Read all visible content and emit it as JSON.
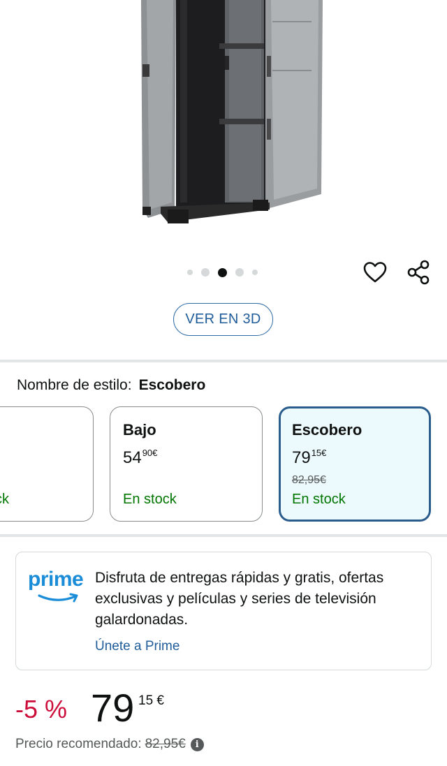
{
  "carousel": {
    "dot_count": 5,
    "active_index": 2
  },
  "actions": {
    "wishlist_icon": "heart-icon",
    "share_icon": "share-icon"
  },
  "view3d": {
    "label": "VER EN 3D"
  },
  "style": {
    "label": "Nombre de estilo:",
    "selected": "Escobero",
    "options": [
      {
        "name": "",
        "price_whole": "",
        "price_fraction": "",
        "currency": "",
        "old_price": "",
        "stock": "ck"
      },
      {
        "name": "Bajo",
        "price_whole": "54",
        "price_fraction": "90",
        "currency": "€",
        "old_price": "",
        "stock": "En stock"
      },
      {
        "name": "Escobero",
        "price_whole": "79",
        "price_fraction": "15",
        "currency": "€",
        "old_price": "82,95€",
        "stock": "En stock"
      }
    ]
  },
  "prime": {
    "logo_text": "prime",
    "description": "Disfruta de entregas rápidas y gratis, ofertas exclusivas y películas y series de televisión galardonadas.",
    "link": "Únete a Prime"
  },
  "price": {
    "discount": "-5 %",
    "whole": "79",
    "fraction_currency": "15 €",
    "list_label": "Precio recomendado:",
    "list_price": "82,95€",
    "info_icon": "info-icon"
  },
  "colors": {
    "accent_blue": "#2a5d8c",
    "link_blue": "#1f5c99",
    "prime_blue": "#1a8cd8",
    "stock_green": "#007600",
    "discount_red": "#cc0c39"
  }
}
